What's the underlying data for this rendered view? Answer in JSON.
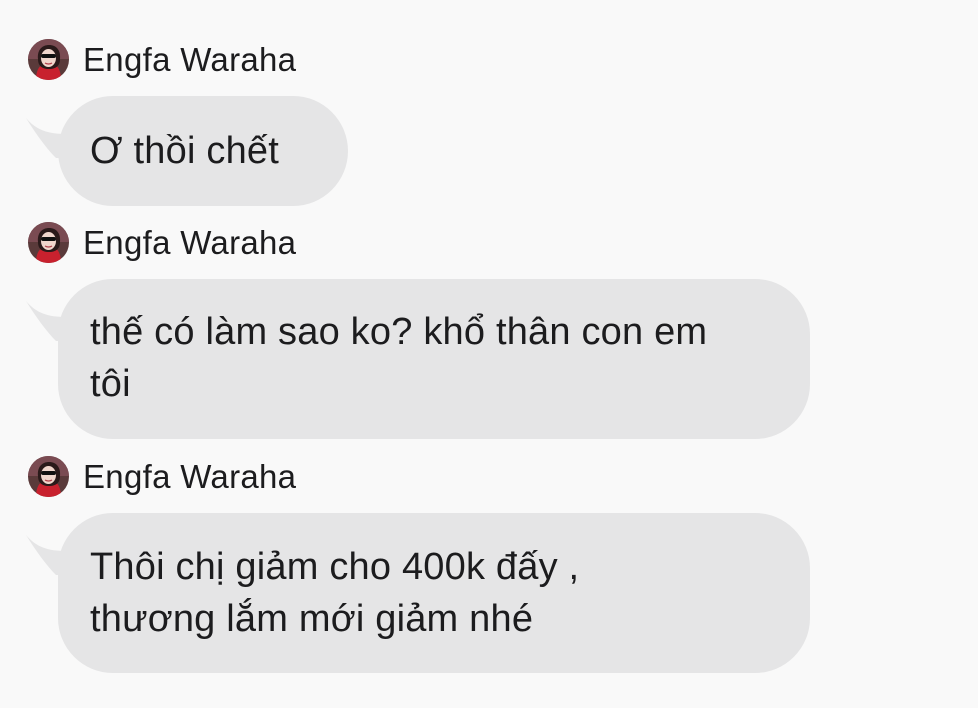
{
  "chat": {
    "messages": [
      {
        "sender": "Engfa Waraha",
        "avatar_icon": "profile-photo-avatar",
        "text": "Ơ thồi chết"
      },
      {
        "sender": "Engfa Waraha",
        "avatar_icon": "profile-photo-avatar",
        "text": "thế có làm sao ko? khổ thân con em tôi"
      },
      {
        "sender": "Engfa Waraha",
        "avatar_icon": "profile-photo-avatar",
        "text": "Thôi chị giảm cho 400k đấy , thương lắm mới giảm nhé"
      }
    ]
  },
  "colors": {
    "background": "#f9f9f9",
    "bubble": "#e5e5e6",
    "text": "#1c1c1e"
  }
}
